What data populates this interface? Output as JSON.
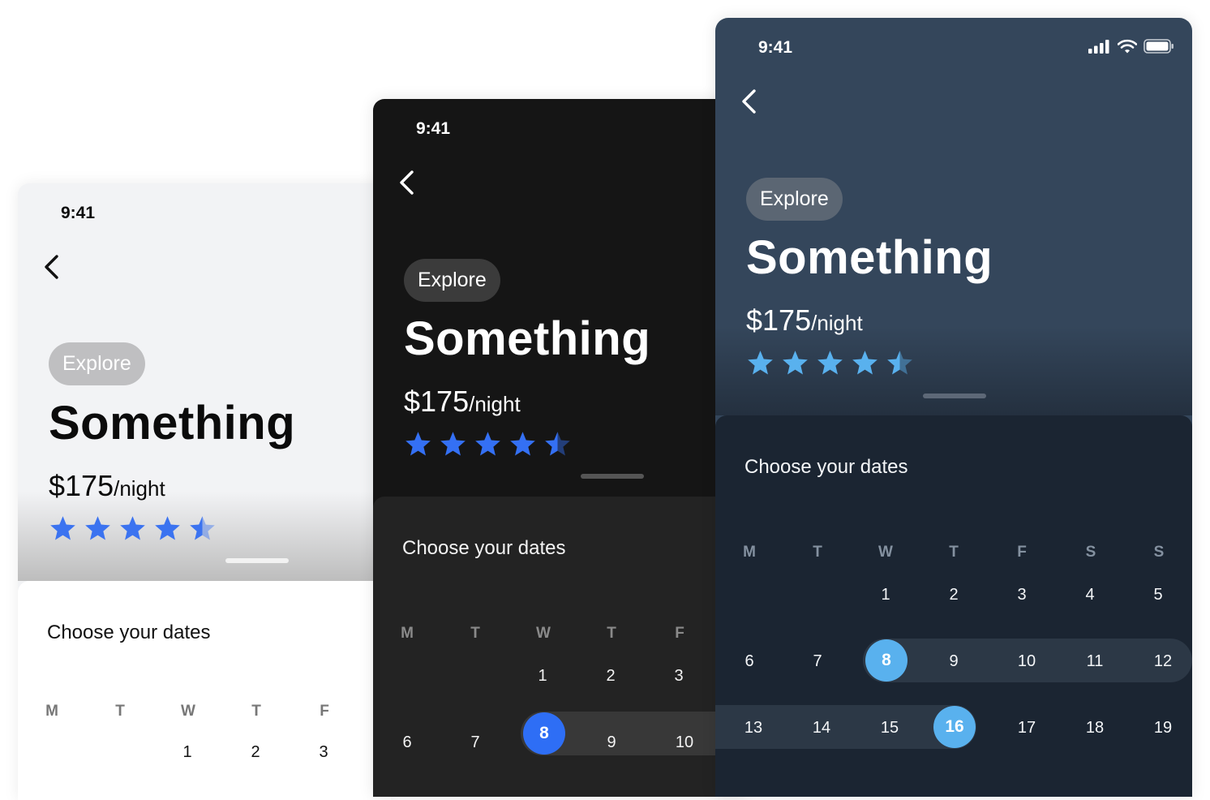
{
  "colors": {
    "star_light": "#3b73f0",
    "star_dark": "#3470f4",
    "star_navy": "#59b1ee",
    "selected_dark": "#2e6ef5",
    "selected_navy": "#59b1ee"
  },
  "screens": [
    {
      "theme": "light",
      "status_time": "9:41",
      "chip": "Explore",
      "title": "Something",
      "price_amount": "$175",
      "price_unit": "/night",
      "rating": 4.5,
      "sheet_title": "Choose your dates",
      "weekdays": [
        "M",
        "T",
        "W",
        "T",
        "F"
      ],
      "week1": [
        "1",
        "2",
        "3"
      ]
    },
    {
      "theme": "dark",
      "status_time": "9:41",
      "chip": "Explore",
      "title": "Something",
      "price_amount": "$175",
      "price_unit": "/night",
      "rating": 4.5,
      "sheet_title": "Choose your dates",
      "weekdays": [
        "M",
        "T",
        "W",
        "T",
        "F"
      ],
      "week1": [
        "1",
        "2",
        "3"
      ],
      "week2": [
        "6",
        "7",
        "8",
        "9",
        "10"
      ],
      "selected_day": "8"
    },
    {
      "theme": "navy",
      "status_time": "9:41",
      "chip": "Explore",
      "title": "Something",
      "price_amount": "$175",
      "price_unit": "/night",
      "rating": 4.5,
      "sheet_title": "Choose your dates",
      "weekdays": [
        "M",
        "T",
        "W",
        "T",
        "F",
        "S",
        "S"
      ],
      "week1": [
        "1",
        "2",
        "3",
        "4",
        "5"
      ],
      "week2": [
        "6",
        "7",
        "8",
        "9",
        "10",
        "11",
        "12"
      ],
      "week3": [
        "13",
        "14",
        "15",
        "16",
        "17",
        "18",
        "19"
      ],
      "range_start": "8",
      "range_end": "16"
    }
  ]
}
